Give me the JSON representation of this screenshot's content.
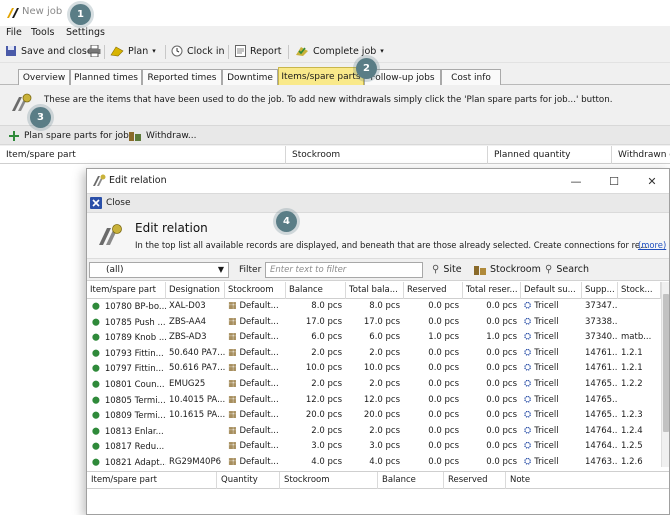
{
  "window": {
    "title": "New job"
  },
  "menu": [
    "File",
    "Tools",
    "Settings"
  ],
  "toolbar": {
    "save_close": "Save and close",
    "plan": "Plan",
    "clock_in": "Clock in",
    "report": "Report",
    "complete_job": "Complete job"
  },
  "tabs": [
    "Overview",
    "Planned times",
    "Reported times",
    "Downtime",
    "Items/spare parts",
    "Follow-up jobs",
    "Cost info"
  ],
  "active_tab": "Items/spare parts",
  "info": {
    "message": "These are the items that have been used to do the job. To add new withdrawals simply click the 'Plan spare parts for job...' button."
  },
  "actions": {
    "plan_spare_parts": "Plan spare parts for job",
    "withdraw": "Withdraw..."
  },
  "grid": {
    "columns": [
      "Item/spare part",
      "Stockroom",
      "Planned quantity",
      "Withdrawn q"
    ]
  },
  "badges": [
    "1",
    "2",
    "3",
    "4"
  ],
  "colors": {
    "active_tab": "#f9e98a",
    "badge": "#5a7d86",
    "link": "#1f4fbf",
    "item_icon": "#2f8a3a"
  },
  "dialog": {
    "title": "Edit relation",
    "close_label": "Close",
    "heading": "Edit relation",
    "description": "In the top list all available records are displayed, and beneath that are those already selected. Create connections for re...",
    "more_link": "(more)",
    "filter": {
      "combo_value": "(all)",
      "label": "Filter",
      "placeholder": "Enter text to filter",
      "site": "Site",
      "stockroom": "Stockroom",
      "search": "Search"
    },
    "columns": [
      "Item/spare part",
      "Designation",
      "Stockroom",
      "Balance",
      "Total bala...",
      "Reserved",
      "Total reser...",
      "Default su...",
      "Supp...",
      "Stock..."
    ],
    "rows": [
      [
        "10780 BP-bo...",
        "XAL-D03",
        "Default...",
        "8.0 pcs",
        "8.0 pcs",
        "0.0 pcs",
        "0.0 pcs",
        "Tricell",
        "37347...",
        ""
      ],
      [
        "10785 Push ...",
        "ZBS-AA4",
        "Default...",
        "17.0 pcs",
        "17.0 pcs",
        "0.0 pcs",
        "0.0 pcs",
        "Tricell",
        "37338...",
        ""
      ],
      [
        "10789 Knob ...",
        "ZBS-AD3",
        "Default...",
        "6.0 pcs",
        "6.0 pcs",
        "1.0 pcs",
        "1.0 pcs",
        "Tricell",
        "37340...",
        "matb..."
      ],
      [
        "10793 Fittin...",
        "50.640 PA7...",
        "Default...",
        "2.0 pcs",
        "2.0 pcs",
        "0.0 pcs",
        "0.0 pcs",
        "Tricell",
        "14761...",
        "1.2.1"
      ],
      [
        "10797 Fittin...",
        "50.616 PA7...",
        "Default...",
        "10.0 pcs",
        "10.0 pcs",
        "0.0 pcs",
        "0.0 pcs",
        "Tricell",
        "14761...",
        "1.2.1"
      ],
      [
        "10801 Coun...",
        "EMUG25",
        "Default...",
        "2.0 pcs",
        "2.0 pcs",
        "0.0 pcs",
        "0.0 pcs",
        "Tricell",
        "14765...",
        "1.2.2"
      ],
      [
        "10805 Termi...",
        "10.4015 PA...",
        "Default...",
        "12.0 pcs",
        "12.0 pcs",
        "0.0 pcs",
        "0.0 pcs",
        "Tricell",
        "14765...",
        ""
      ],
      [
        "10809 Termi...",
        "10.1615 PA...",
        "Default...",
        "20.0 pcs",
        "20.0 pcs",
        "0.0 pcs",
        "0.0 pcs",
        "Tricell",
        "14765...",
        "1.2.3"
      ],
      [
        "10813 Enlar...",
        "",
        "Default...",
        "2.0 pcs",
        "2.0 pcs",
        "0.0 pcs",
        "0.0 pcs",
        "Tricell",
        "14764...",
        "1.2.4"
      ],
      [
        "10817 Redu...",
        "",
        "Default...",
        "3.0 pcs",
        "3.0 pcs",
        "0.0 pcs",
        "0.0 pcs",
        "Tricell",
        "14764...",
        "1.2.5"
      ],
      [
        "10821 Adapt...",
        "RG29M40P6",
        "Default...",
        "4.0 pcs",
        "4.0 pcs",
        "0.0 pcs",
        "0.0 pcs",
        "Tricell",
        "14763...",
        "1.2.6"
      ]
    ],
    "selected_columns": [
      "Item/spare part",
      "Quantity",
      "Stockroom",
      "Balance",
      "Reserved",
      "Note"
    ]
  }
}
